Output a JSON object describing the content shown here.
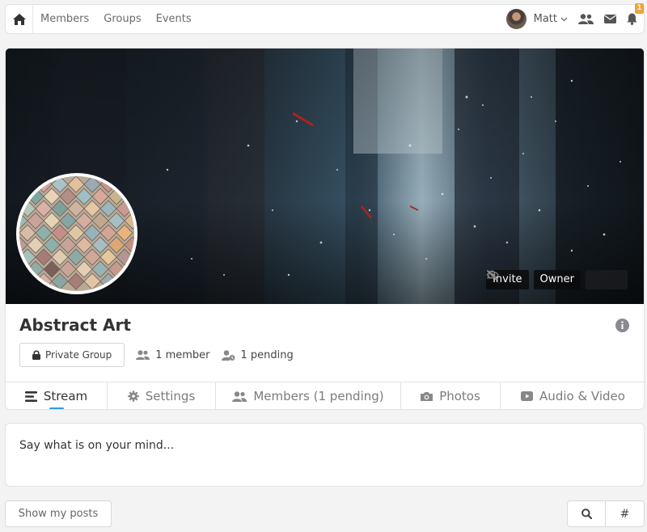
{
  "nav": {
    "links": [
      "Members",
      "Groups",
      "Events"
    ],
    "user_name": "Matt",
    "notification_count": "1"
  },
  "group": {
    "title": "Abstract Art",
    "privacy_label": "Private Group",
    "member_count": "1 member",
    "pending_count": "1 pending",
    "banner_actions": {
      "invite": "Invite",
      "owner": "Owner"
    }
  },
  "tabs": [
    {
      "label": "Stream",
      "icon": "stream-icon"
    },
    {
      "label": "Settings",
      "icon": "gear-icon"
    },
    {
      "label": "Members (1 pending)",
      "icon": "users-icon"
    },
    {
      "label": "Photos",
      "icon": "camera-icon"
    },
    {
      "label": "Audio & Video",
      "icon": "video-icon"
    }
  ],
  "composer": {
    "placeholder": "Say what is on your mind..."
  },
  "toolbar": {
    "show_my_posts": "Show my posts",
    "hashtag": "#"
  },
  "colors": {
    "accent": "#2f9de3",
    "badge": "#f0a33a"
  }
}
